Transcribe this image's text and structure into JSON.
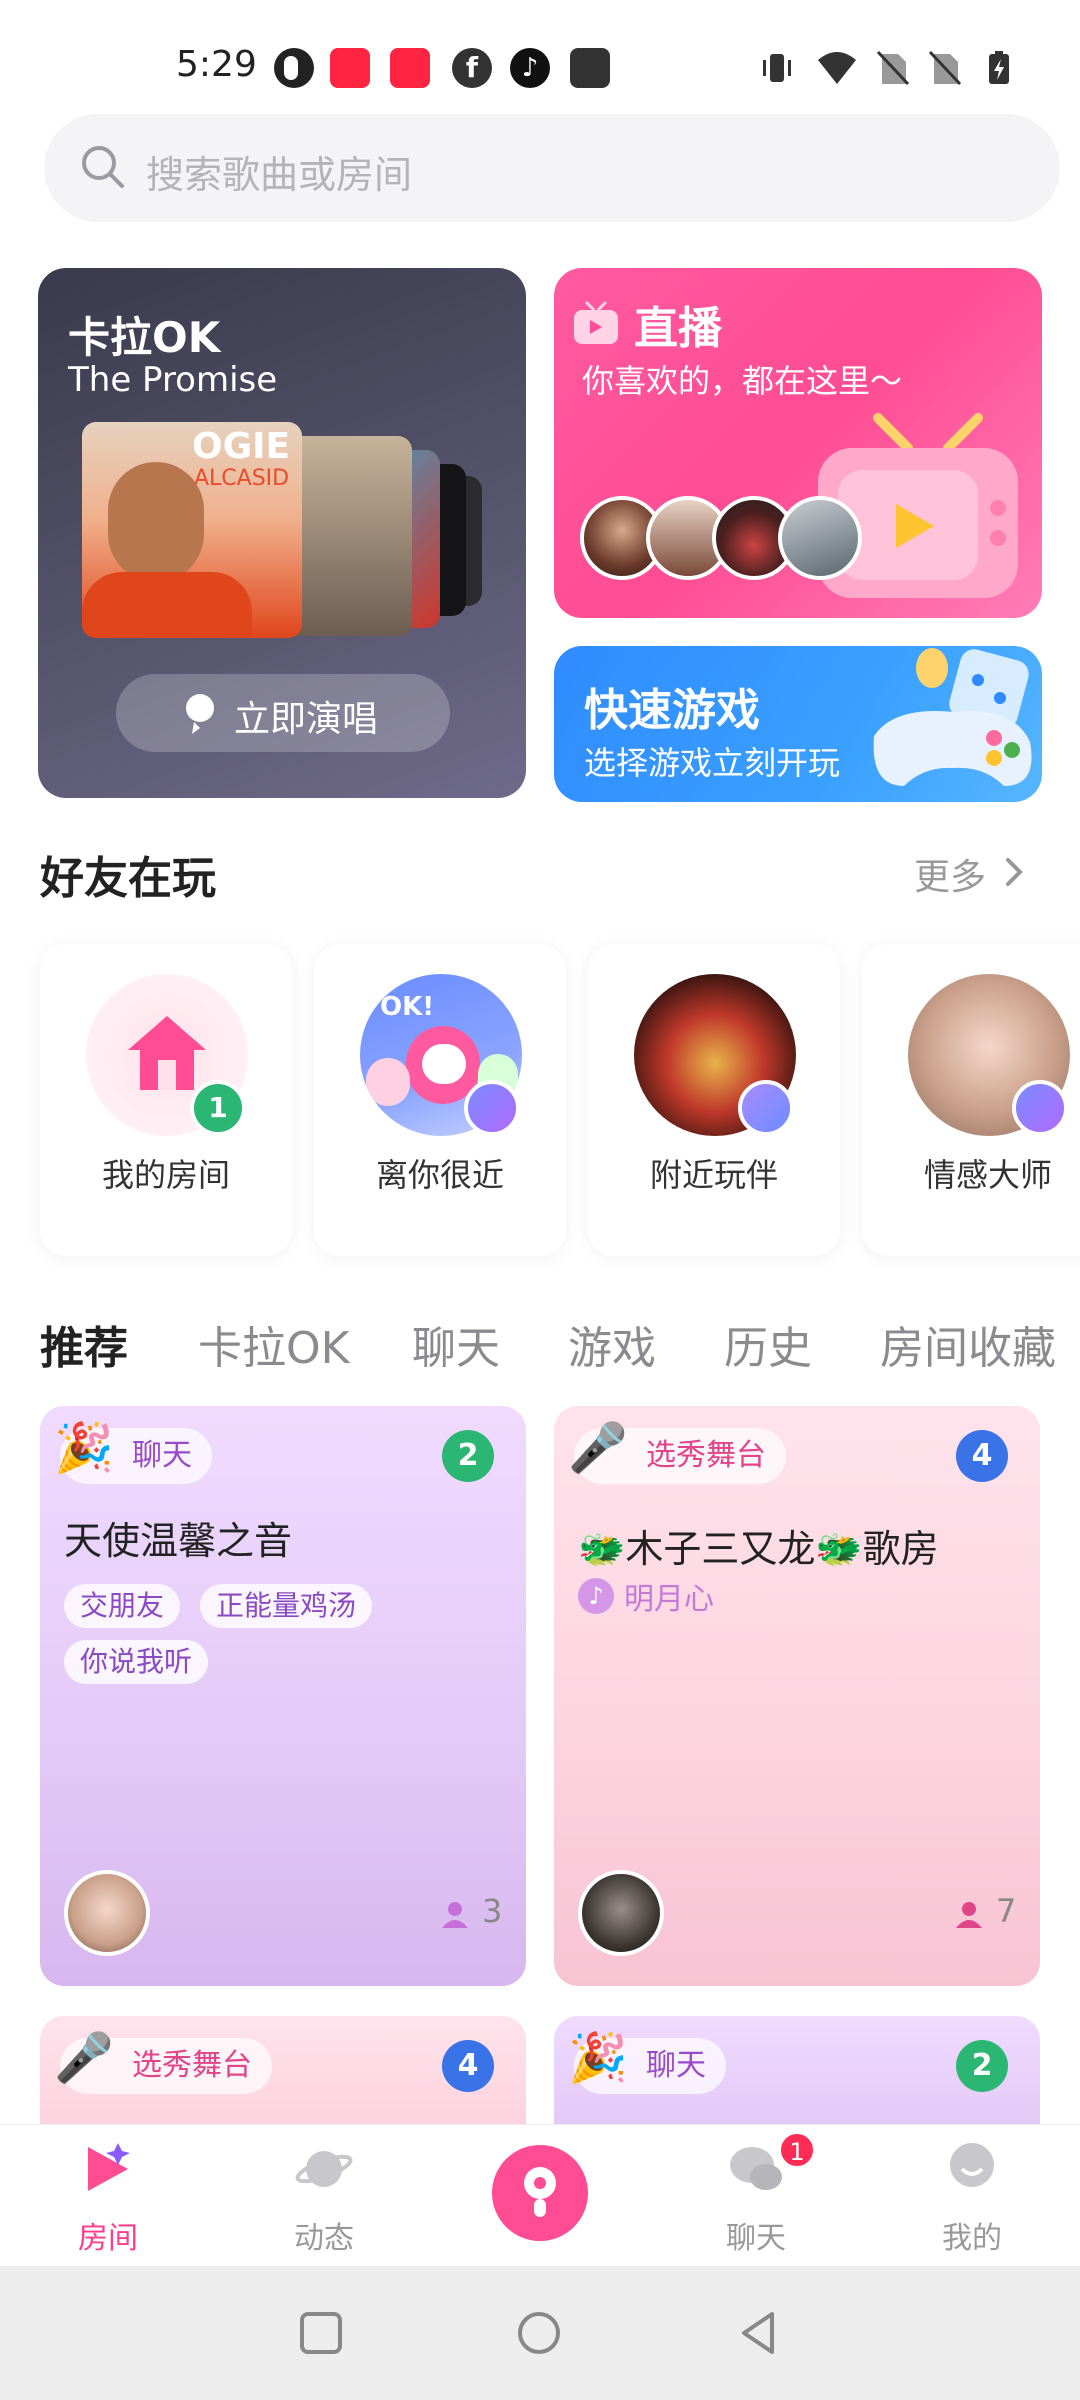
{
  "status_bar": {
    "time": "5:29",
    "left_icons": [
      "app-icon",
      "xiaohongshu-icon",
      "xiaohongshu-icon",
      "facebook-icon",
      "tiktok-icon",
      "inbox-icon"
    ],
    "right_icons": [
      "vibrate-icon",
      "wifi-icon",
      "no-sim-icon",
      "no-sim-icon",
      "battery-charging-icon"
    ]
  },
  "search": {
    "placeholder": "搜索歌曲或房间"
  },
  "karaoke_card": {
    "title": "卡拉OK",
    "song": "The Promise",
    "cover_text": "OGIE",
    "cover_subtext": "ALCASID",
    "button_label": "立即演唱"
  },
  "live_card": {
    "title": "直播",
    "subtitle": "你喜欢的，都在这里～"
  },
  "game_card": {
    "title": "快速游戏",
    "subtitle": "选择游戏立刻开玩"
  },
  "friends": {
    "title": "好友在玩",
    "more": "更多",
    "items": [
      {
        "label": "我的房间",
        "badge": "1"
      },
      {
        "label": "离你很近",
        "art_text": "OK!"
      },
      {
        "label": "附近玩伴"
      },
      {
        "label": "情感大师"
      }
    ]
  },
  "tabs": [
    "推荐",
    "卡拉OK",
    "聊天",
    "游戏",
    "历史",
    "房间收藏"
  ],
  "rooms": [
    {
      "tag": "聊天",
      "level": "2",
      "name": "天使温馨之音",
      "chips": [
        "交朋友",
        "正能量鸡汤",
        "你说我听"
      ],
      "count": "3"
    },
    {
      "tag": "选秀舞台",
      "level": "4",
      "name": "🐲木子三又龙🐲歌房",
      "owner": "明月心",
      "count": "7"
    },
    {
      "tag": "选秀舞台",
      "level": "4"
    },
    {
      "tag": "聊天",
      "level": "2"
    }
  ],
  "bottom_nav": {
    "items": [
      "房间",
      "动态",
      "",
      "聊天",
      "我的"
    ],
    "chat_badge": "1"
  },
  "colors": {
    "accent": "#ff4c93",
    "live_bg": "#ff5aa0",
    "game_bg": "#2f8bff",
    "karaoke_bg": "#4a495f"
  }
}
